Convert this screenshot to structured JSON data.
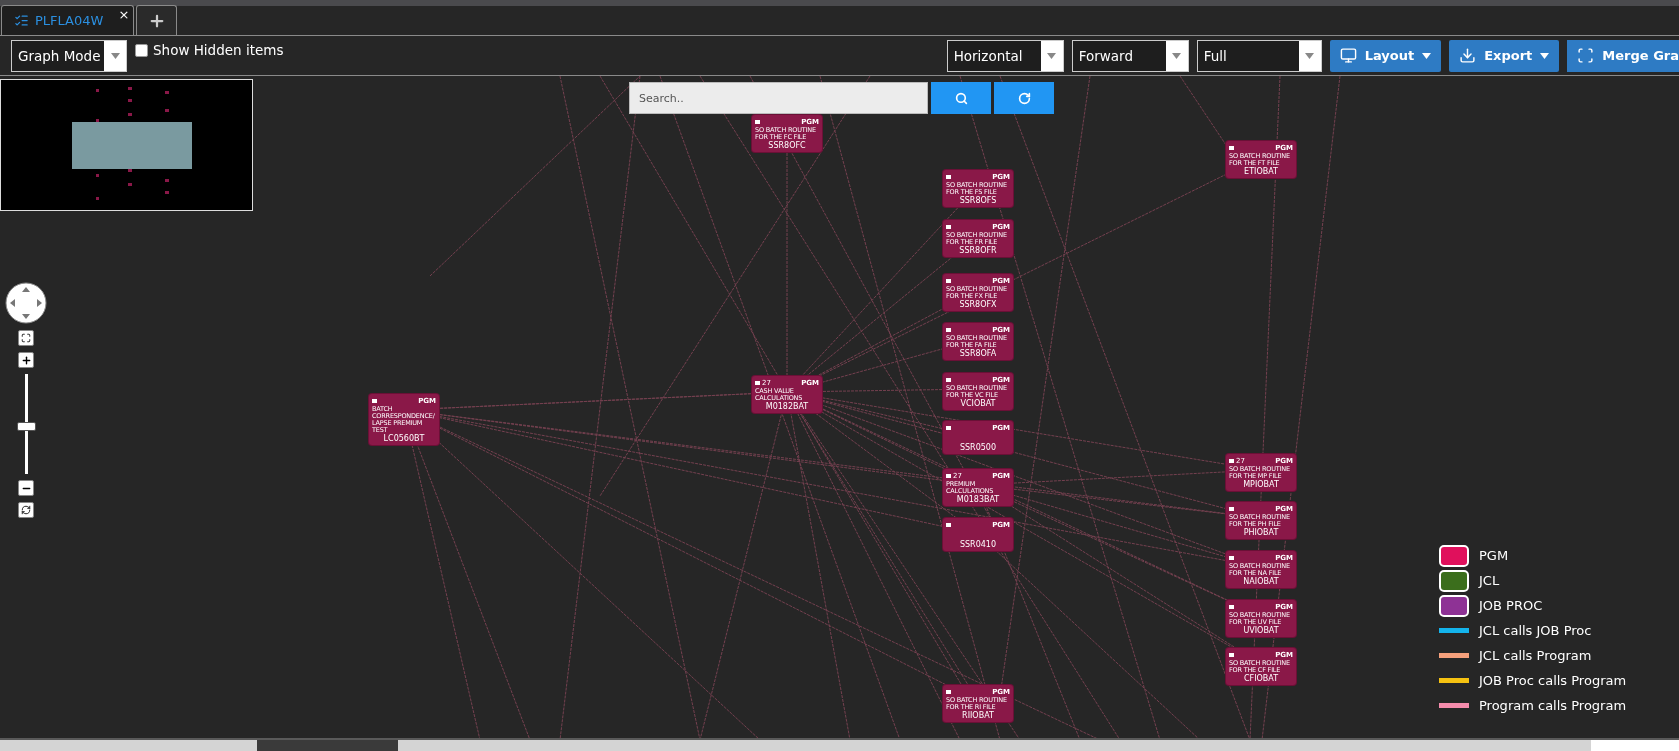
{
  "tabs": [
    {
      "label": "PLFLA04W",
      "selected": true,
      "close": "×"
    }
  ],
  "toolbar": {
    "mode": "Graph Mode",
    "show_hidden": {
      "label": "Show Hidden items",
      "checked": false
    },
    "orientation": "Horizontal",
    "direction": "Forward",
    "scope": "Full",
    "buttons": [
      {
        "label": "Layout",
        "kind": "menu"
      },
      {
        "label": "Export",
        "kind": "menu"
      },
      {
        "label": "Merge Gra",
        "kind": "plain"
      }
    ]
  },
  "search": {
    "placeholder": "Search.."
  },
  "zoom": {
    "level": 0.48
  },
  "nodes": [
    {
      "name": "SSR8OFC",
      "type": "PGM",
      "description": "SO BATCH ROUTINE FOR THE FC FILE"
    },
    {
      "name": "ETIOBAT",
      "type": "PGM",
      "description": "SO BATCH ROUTINE FOR THE FT FILE"
    },
    {
      "name": "SSR8OFS",
      "type": "PGM",
      "description": "SO BATCH ROUTINE FOR THE FS FILE"
    },
    {
      "name": "SSR8OFR",
      "type": "PGM",
      "description": "SO BATCH ROUTINE FOR THE FR FILE"
    },
    {
      "name": "SSR8OFX",
      "type": "PGM",
      "description": "SO BATCH ROUTINE FOR THE FX FILE"
    },
    {
      "name": "SSR8OFA",
      "type": "PGM",
      "description": "SO BATCH ROUTINE FOR THE FA FILE"
    },
    {
      "name": "LC0560BT",
      "type": "PGM",
      "description": "BATCH CORRESPONDENCE/LAPSE PREMIUM TEST"
    },
    {
      "name": "M0182BAT",
      "type": "PGM",
      "count": "27",
      "description": "CASH VALUE CALCULATIONS"
    },
    {
      "name": "VCIOBAT",
      "type": "PGM",
      "description": "SO BATCH ROUTINE FOR THE VC FILE"
    },
    {
      "name": "SSR0500",
      "type": "PGM"
    },
    {
      "name": "MPIOBAT",
      "type": "PGM",
      "count": "27",
      "description": "SO BATCH ROUTINE FOR THE MP FILE"
    },
    {
      "name": "M0183BAT",
      "type": "PGM",
      "count": "27",
      "description": "PREMIUM CALCULATIONS"
    },
    {
      "name": "PHIOBAT",
      "type": "PGM",
      "description": "SO BATCH ROUTINE FOR THE PH FILE"
    },
    {
      "name": "SSR0410",
      "type": "PGM"
    },
    {
      "name": "NAIOBAT",
      "type": "PGM",
      "description": "SO BATCH ROUTINE FOR THE NA FILE"
    },
    {
      "name": "UVIOBAT",
      "type": "PGM",
      "description": "SO BATCH ROUTINE FOR THE UV FILE"
    },
    {
      "name": "CFIOBAT",
      "type": "PGM",
      "description": "SO BATCH ROUTINE FOR THE CF FILE"
    },
    {
      "name": "RIIOBAT",
      "type": "PGM",
      "description": "SO BATCH ROUTINE FOR THE RI FILE"
    }
  ],
  "legend": [
    {
      "label": "PGM",
      "kind": "box",
      "color": "#e0105c"
    },
    {
      "label": "JCL",
      "kind": "box",
      "color": "#3b6e1c"
    },
    {
      "label": "JOB PROC",
      "kind": "box",
      "color": "#8e3295"
    },
    {
      "label": "JCL calls JOB Proc",
      "kind": "line",
      "color": "#14b4ec"
    },
    {
      "label": "JCL calls Program",
      "kind": "line",
      "color": "#f5a07c"
    },
    {
      "label": "JOB Proc calls Program",
      "kind": "line",
      "color": "#f5c211"
    },
    {
      "label": "Program calls Program",
      "kind": "line",
      "color": "#f58cac"
    }
  ]
}
